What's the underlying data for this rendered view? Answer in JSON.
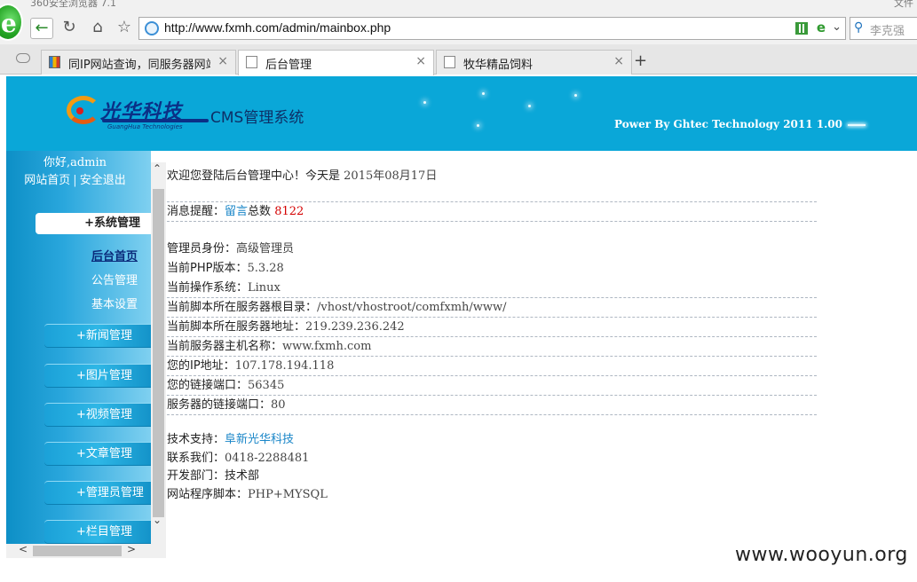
{
  "browser": {
    "window_title": "360安全浏览器 7.1",
    "top_right": "文件",
    "url": "http://www.fxmh.com/admin/mainbox.php",
    "search_placeholder": "李克强",
    "tabs": [
      {
        "label": "同IP网站查询，同服务器网站",
        "active": false
      },
      {
        "label": "后台管理",
        "active": true
      },
      {
        "label": "牧华精品饲料",
        "active": false
      }
    ],
    "new_tab": "+",
    "close_glyph": "×"
  },
  "header": {
    "brand": "光华科技",
    "brand_en": "GuangHua Technologies",
    "cms_title": "CMS管理系统",
    "powered_by": "Power By Ghtec Technology 2011 1.00"
  },
  "sidebar": {
    "greeting": "你好,admin",
    "home_link": "网站首页",
    "separator": "|",
    "logout_link": "安全退出",
    "system_menu": "+系统管理",
    "submenu": [
      "后台首页",
      "公告管理",
      "基本设置"
    ],
    "menus": [
      "+新闻管理",
      "+图片管理",
      "+视频管理",
      "+文章管理",
      "+管理员管理",
      "+栏目管理"
    ]
  },
  "main": {
    "welcome": "欢迎您登陆后台管理中心！今天是",
    "date": "2015年08月17日",
    "notice_label": "消息提醒：",
    "notice_link": "留言",
    "notice_suffix": "总数",
    "notice_count": "8122",
    "info": [
      {
        "label": "管理员身份：",
        "value": "高级管理员"
      },
      {
        "label": "当前PHP版本：",
        "value": "5.3.28"
      },
      {
        "label": "当前操作系统：",
        "value": "Linux"
      },
      {
        "label": "当前脚本所在服务器根目录：",
        "value": "/vhost/vhostroot/comfxmh/www/"
      },
      {
        "label": "当前脚本所在服务器地址：",
        "value": "219.239.236.242"
      },
      {
        "label": "当前服务器主机名称：",
        "value": "www.fxmh.com"
      },
      {
        "label": "您的IP地址：",
        "value": "107.178.194.118"
      },
      {
        "label": "您的链接端口：",
        "value": "56345"
      },
      {
        "label": "服务器的链接端口：",
        "value": "80"
      }
    ],
    "support_label": "技术支持：",
    "support_link": "阜新光华科技",
    "contact_label": "联系我们：",
    "contact_value": "0418-2288481",
    "dept_label": "开发部门：",
    "dept_value": "技术部",
    "script_label": "网站程序脚本：",
    "script_value": "PHP+MYSQL"
  },
  "watermark": "www.wooyun.org",
  "colors": {
    "header_bg": "#0aa7d8",
    "sidebar": "#1ba1d8",
    "link": "#1a86c8",
    "count": "#d40000"
  }
}
